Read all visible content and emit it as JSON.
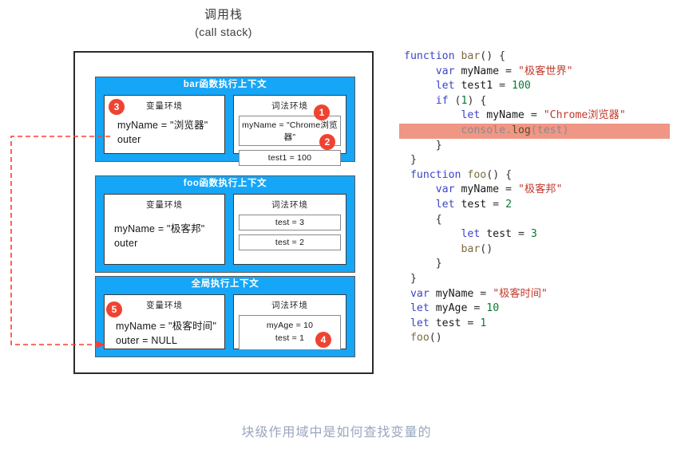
{
  "title": {
    "cn": "调用栈",
    "en": "(call stack)"
  },
  "caption": "块级作用域中是如何查找变量的",
  "colors": {
    "context_blue": "#16a6f7",
    "badge_red": "#ef4331",
    "highlight_salmon": "#f09685",
    "arrow_red": "#ff3b30",
    "caption_gray": "#9aa7bf"
  },
  "env_labels": {
    "variable": "变量环境",
    "lexical": "词法环境"
  },
  "contexts": [
    {
      "id": "bar",
      "header": "bar函数执行上下文",
      "variable_env": {
        "title": "变量环境",
        "lines": [
          "myName = \"浏览器\"",
          "outer"
        ]
      },
      "lexical_env": {
        "title": "词法环境",
        "slots": [
          "myName = \"Chrome浏览器\"",
          "test1 = 100"
        ]
      }
    },
    {
      "id": "foo",
      "header": "foo函数执行上下文",
      "variable_env": {
        "title": "变量环境",
        "lines": [
          "myName = \"极客邦\"",
          "outer"
        ]
      },
      "lexical_env": {
        "title": "词法环境",
        "slots": [
          "test = 3",
          "test = 2"
        ]
      }
    },
    {
      "id": "global",
      "header": "全局执行上下文",
      "variable_env": {
        "title": "变量环境",
        "lines": [
          "myName = \"极客时间\"",
          "outer = NULL"
        ]
      },
      "lexical_env": {
        "title": "词法环境",
        "slots": [
          "myAge = 10\ntest = 1"
        ]
      }
    }
  ],
  "badges": [
    {
      "num": "1",
      "target": "bar-lexical-myName"
    },
    {
      "num": "2",
      "target": "bar-lexical-test1"
    },
    {
      "num": "3",
      "target": "bar-variable-env"
    },
    {
      "num": "4",
      "target": "global-lexical-slot"
    },
    {
      "num": "5",
      "target": "global-variable-env"
    }
  ],
  "code": {
    "lines": [
      [
        {
          "t": "function ",
          "c": "k"
        },
        {
          "t": "bar",
          "c": "fn"
        },
        {
          "t": "() {",
          "c": "pn"
        }
      ],
      [
        {
          "t": "     ",
          "c": "pn"
        },
        {
          "t": "var ",
          "c": "k"
        },
        {
          "t": "myName",
          "c": "id"
        },
        {
          "t": " = ",
          "c": "pn"
        },
        {
          "t": "\"极客世界\"",
          "c": "st"
        }
      ],
      [
        {
          "t": "     ",
          "c": "pn"
        },
        {
          "t": "let ",
          "c": "k"
        },
        {
          "t": "test1",
          "c": "id"
        },
        {
          "t": " = ",
          "c": "pn"
        },
        {
          "t": "100",
          "c": "nu"
        }
      ],
      [
        {
          "t": "     ",
          "c": "pn"
        },
        {
          "t": "if ",
          "c": "k"
        },
        {
          "t": "(",
          "c": "pn"
        },
        {
          "t": "1",
          "c": "nu"
        },
        {
          "t": ") {",
          "c": "pn"
        }
      ],
      [
        {
          "t": "         ",
          "c": "pn"
        },
        {
          "t": "let ",
          "c": "k"
        },
        {
          "t": "myName",
          "c": "id"
        },
        {
          "t": " = ",
          "c": "pn"
        },
        {
          "t": "\"Chrome浏览器\"",
          "c": "st"
        }
      ],
      [
        {
          "t": "         ",
          "c": "pn"
        },
        {
          "t": "console",
          "c": "dim"
        },
        {
          "t": ".",
          "c": "dim"
        },
        {
          "t": "log",
          "c": "oc"
        },
        {
          "t": "(",
          "c": "dim"
        },
        {
          "t": "test",
          "c": "dim"
        },
        {
          "t": ")",
          "c": "dim"
        }
      ],
      [
        {
          "t": "     }",
          "c": "pn"
        }
      ],
      [
        {
          "t": " }",
          "c": "pn"
        }
      ],
      [
        {
          "t": " ",
          "c": "pn"
        },
        {
          "t": "function ",
          "c": "k"
        },
        {
          "t": "foo",
          "c": "fn"
        },
        {
          "t": "() {",
          "c": "pn"
        }
      ],
      [
        {
          "t": "     ",
          "c": "pn"
        },
        {
          "t": "var ",
          "c": "k"
        },
        {
          "t": "myName",
          "c": "id"
        },
        {
          "t": " = ",
          "c": "pn"
        },
        {
          "t": "\"极客邦\"",
          "c": "st"
        }
      ],
      [
        {
          "t": "     ",
          "c": "pn"
        },
        {
          "t": "let ",
          "c": "k"
        },
        {
          "t": "test",
          "c": "id"
        },
        {
          "t": " = ",
          "c": "pn"
        },
        {
          "t": "2",
          "c": "nu"
        }
      ],
      [
        {
          "t": "     {",
          "c": "pn"
        }
      ],
      [
        {
          "t": "         ",
          "c": "pn"
        },
        {
          "t": "let ",
          "c": "k"
        },
        {
          "t": "test",
          "c": "id"
        },
        {
          "t": " = ",
          "c": "pn"
        },
        {
          "t": "3",
          "c": "nu"
        }
      ],
      [
        {
          "t": "         ",
          "c": "pn"
        },
        {
          "t": "bar",
          "c": "fn"
        },
        {
          "t": "()",
          "c": "pn"
        }
      ],
      [
        {
          "t": "     }",
          "c": "pn"
        }
      ],
      [
        {
          "t": " }",
          "c": "pn"
        }
      ],
      [
        {
          "t": " ",
          "c": "pn"
        },
        {
          "t": "var ",
          "c": "k"
        },
        {
          "t": "myName",
          "c": "id"
        },
        {
          "t": " = ",
          "c": "pn"
        },
        {
          "t": "\"极客时间\"",
          "c": "st"
        }
      ],
      [
        {
          "t": " ",
          "c": "pn"
        },
        {
          "t": "let ",
          "c": "k"
        },
        {
          "t": "myAge",
          "c": "id"
        },
        {
          "t": " = ",
          "c": "pn"
        },
        {
          "t": "10",
          "c": "nu"
        }
      ],
      [
        {
          "t": " ",
          "c": "pn"
        },
        {
          "t": "let ",
          "c": "k"
        },
        {
          "t": "test",
          "c": "id"
        },
        {
          "t": " = ",
          "c": "pn"
        },
        {
          "t": "1",
          "c": "nu"
        }
      ],
      [
        {
          "t": " ",
          "c": "pn"
        },
        {
          "t": "foo",
          "c": "fn"
        },
        {
          "t": "()",
          "c": "pn"
        }
      ]
    ],
    "highlighted_line_index": 5
  }
}
